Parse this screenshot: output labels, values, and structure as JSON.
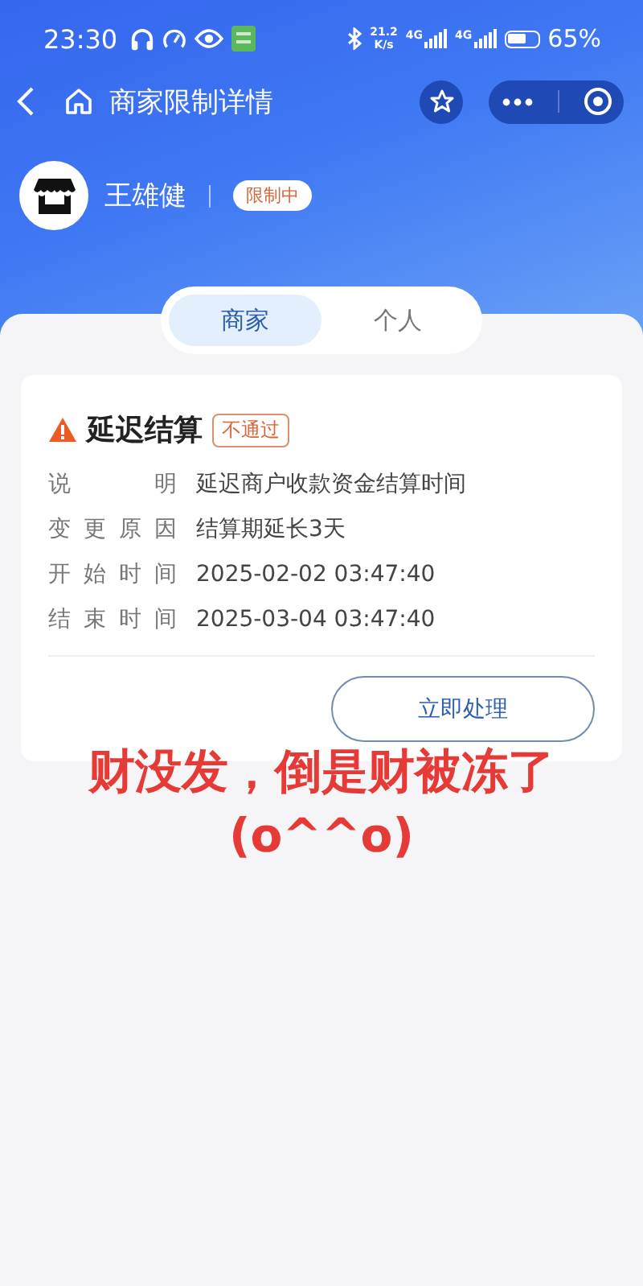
{
  "status_bar": {
    "time": "23:30",
    "net_speed_value": "21.2",
    "net_speed_unit": "K/s",
    "network_1": "4G",
    "network_2": "4G",
    "battery": "65%"
  },
  "nav_bar": {
    "title": "商家限制详情"
  },
  "profile": {
    "name": "王雄健",
    "status": "限制中"
  },
  "tabs": [
    {
      "label": "商家",
      "selected": true
    },
    {
      "label": "个人",
      "selected": false
    }
  ],
  "card": {
    "title": "延迟结算",
    "result": "不通过",
    "rows": [
      {
        "label": "说明",
        "value": "延迟商户收款资金结算时间"
      },
      {
        "label": "变更原因",
        "value": "结算期延长3天"
      },
      {
        "label": "开始时间",
        "value": "2025-02-02 03:47:40"
      },
      {
        "label": "结束时间",
        "value": "2025-03-04 03:47:40"
      }
    ],
    "action": "立即处理"
  },
  "caption": {
    "line_1": "财没发，倒是财被冻了",
    "line_2": "(o^^o)"
  }
}
